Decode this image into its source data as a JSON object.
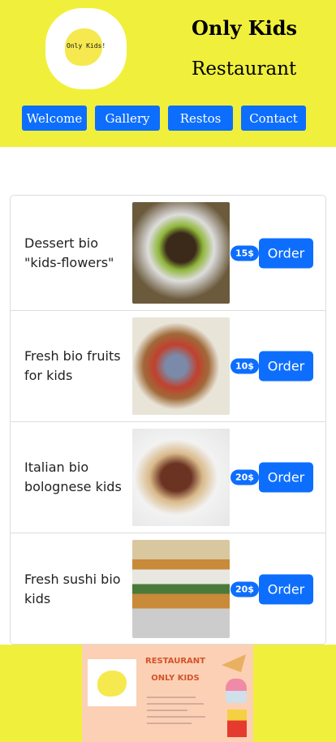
{
  "header": {
    "logo_text": "Only Kids!",
    "title": "Only Kids",
    "subtitle": "Restaurant",
    "nav": [
      "Welcome",
      "Gallery",
      "Restos",
      "Contact"
    ]
  },
  "menu": {
    "items": [
      {
        "name": "Dessert bio \"kids-flowers\"",
        "price": "15$",
        "button": "Order",
        "image": "cake-with-flowers",
        "color": "#6b5a3c"
      },
      {
        "name": "Fresh bio fruits for kids",
        "price": "10$",
        "button": "Order",
        "image": "fruit-bowl",
        "color": "#b56a5a"
      },
      {
        "name": "Italian bio bolognese kids",
        "price": "20$",
        "button": "Order",
        "image": "pasta-bolognese",
        "color": "#c9a385"
      },
      {
        "name": "Fresh sushi bio kids",
        "price": "20$",
        "button": "Order",
        "image": "sushi-rolls",
        "color": "#a7936a"
      }
    ]
  },
  "footer": {
    "line1": "RESTAURANT",
    "line2": "ONLY KIDS"
  },
  "colors": {
    "header_bg": "#f0f03c",
    "accent": "#0d6efd"
  }
}
